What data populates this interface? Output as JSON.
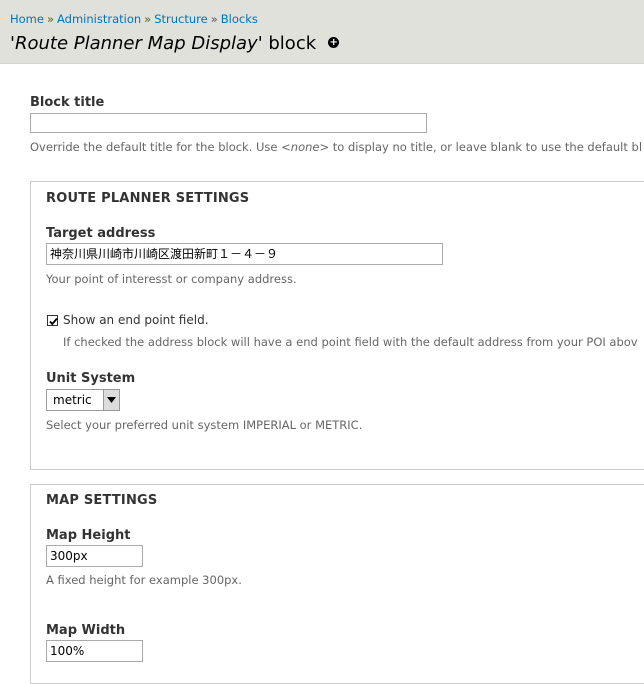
{
  "breadcrumb": {
    "items": [
      "Home",
      "Administration",
      "Structure",
      "Blocks"
    ],
    "separator": "»"
  },
  "page_title": {
    "quote_open": "'",
    "name": "Route Planner Map Display",
    "quote_close": "'",
    "suffix": " block"
  },
  "shortcut_icon": "add-shortcut-icon",
  "block_title": {
    "label": "Block title",
    "value": "",
    "description_before": "Override the default title for the block. Use ",
    "description_em": "<none>",
    "description_after": " to display no title, or leave blank to use the default bl"
  },
  "route_planner": {
    "legend": "ROUTE PLANNER SETTINGS",
    "target_address": {
      "label": "Target address",
      "value": "神奈川県川崎市川崎区渡田新町１－４－９",
      "description": "Your point of interesst or company address."
    },
    "end_point": {
      "checked": true,
      "label": "Show an end point field.",
      "description": "If checked the address block will have a end point field with the default address from your POI abov"
    },
    "unit_system": {
      "label": "Unit System",
      "selected": "metric",
      "description": "Select your preferred unit system IMPERIAL or METRIC."
    }
  },
  "map_settings": {
    "legend": "MAP SETTINGS",
    "map_height": {
      "label": "Map Height",
      "value": "300px",
      "description": "A fixed height for example 300px."
    },
    "map_width": {
      "label": "Map Width",
      "value": "100%"
    }
  },
  "colors": {
    "header_bg": "#e1e1dc",
    "link": "#0074bd"
  }
}
